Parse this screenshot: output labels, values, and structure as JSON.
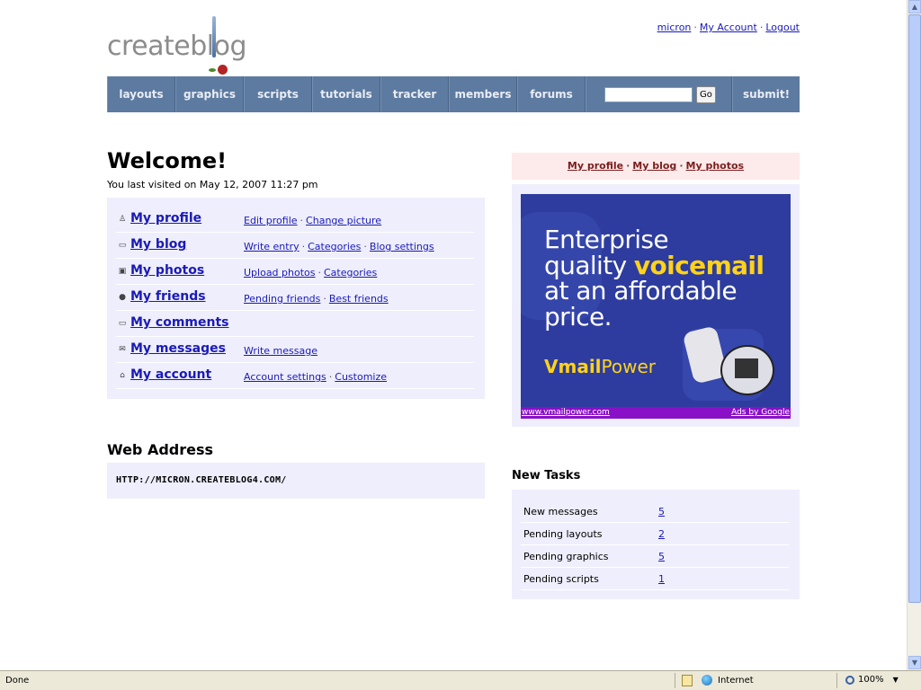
{
  "logo": {
    "text": "createblog"
  },
  "user_links": {
    "username": "micron",
    "my_account": "My Account",
    "logout": "Logout",
    "separator": "·"
  },
  "nav": {
    "items": [
      "layouts",
      "graphics",
      "scripts",
      "tutorials",
      "tracker",
      "members",
      "forums"
    ],
    "search": {
      "value": "",
      "button": "Go"
    },
    "submit": "submit!"
  },
  "welcome": {
    "title": "Welcome!",
    "last_visit": "You last visited on May 12, 2007 11:27 pm"
  },
  "profile_rows": [
    {
      "icon": "user-icon",
      "glyph": "♙",
      "label": "My profile",
      "links": [
        "Edit profile",
        "Change picture"
      ]
    },
    {
      "icon": "speech-bubble-icon",
      "glyph": "▭",
      "label": "My blog",
      "links": [
        "Write entry",
        "Categories",
        "Blog settings"
      ]
    },
    {
      "icon": "photos-icon",
      "glyph": "▣",
      "label": "My photos",
      "links": [
        "Upload photos",
        "Categories"
      ]
    },
    {
      "icon": "globe-icon",
      "glyph": "●",
      "label": "My friends",
      "links": [
        "Pending friends",
        "Best friends"
      ]
    },
    {
      "icon": "speech-bubble-icon",
      "glyph": "▭",
      "label": "My comments",
      "links": []
    },
    {
      "icon": "envelope-icon",
      "glyph": "✉",
      "label": "My messages",
      "links": [
        "Write message"
      ]
    },
    {
      "icon": "house-icon",
      "glyph": "⌂",
      "label": "My account",
      "links": [
        "Account settings",
        "Customize"
      ]
    }
  ],
  "web_address": {
    "title": "Web Address",
    "url": "HTTP://MICRON.CREATEBLOG4.COM/"
  },
  "quick_links": [
    "My profile",
    "My blog",
    "My photos"
  ],
  "ad": {
    "line1": "Enterprise",
    "line2_plain": "quality ",
    "line2_highlight": "voicemail",
    "line3": "at an affordable",
    "line4": "price.",
    "brand_bold": "Vmail",
    "brand_rest": "Power",
    "url": "www.vmailpower.com",
    "ads_by": "Ads by Google"
  },
  "tasks": {
    "title": "New Tasks",
    "rows": [
      {
        "label": "New messages",
        "value": "5"
      },
      {
        "label": "Pending layouts",
        "value": "2"
      },
      {
        "label": "Pending graphics",
        "value": "5"
      },
      {
        "label": "Pending scripts",
        "value": "1"
      }
    ]
  },
  "status_bar": {
    "status": "Done",
    "zone": "Internet",
    "zoom": "100%"
  }
}
